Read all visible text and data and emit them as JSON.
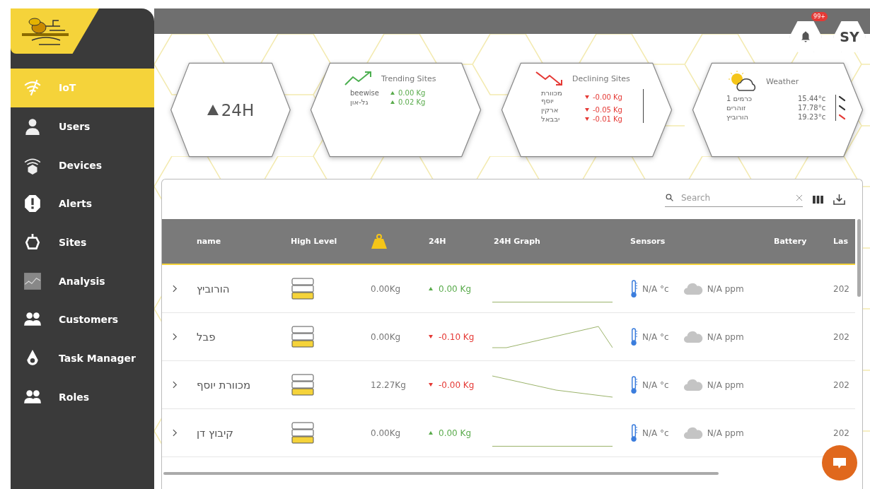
{
  "sidebar": {
    "items": [
      {
        "label": "IoT",
        "selected": true
      },
      {
        "label": "Users",
        "selected": false
      },
      {
        "label": "Devices",
        "selected": false
      },
      {
        "label": "Alerts",
        "selected": false
      },
      {
        "label": "Sites",
        "selected": false
      },
      {
        "label": "Analysis",
        "selected": false
      },
      {
        "label": "Customers",
        "selected": false
      },
      {
        "label": "Task Manager",
        "selected": false
      },
      {
        "label": "Roles",
        "selected": false
      }
    ]
  },
  "header": {
    "notification_count": "99+",
    "user_initials": "SY"
  },
  "summary": {
    "period": "24H",
    "trending": {
      "title": "Trending Sites",
      "rows": [
        {
          "name": "beewise",
          "value": "0.00 Kg"
        },
        {
          "name": "גל-און",
          "value": "0.02 Kg"
        }
      ]
    },
    "declining": {
      "title": "Declining Sites",
      "rows": [
        {
          "name": "מכוורת יוסף",
          "value": "-0.00 Kg"
        },
        {
          "name": "ארקין",
          "value": "-0.05 Kg"
        },
        {
          "name": "יבבאל",
          "value": "-0.01 Kg"
        }
      ]
    },
    "weather": {
      "title": "Weather",
      "rows": [
        {
          "name": "כרמים 1",
          "temp": "15.44°c",
          "alert": false
        },
        {
          "name": "זוהרים",
          "temp": "17.78°c",
          "alert": false
        },
        {
          "name": "הורוביץ",
          "temp": "19.23°c",
          "alert": true
        }
      ]
    }
  },
  "table": {
    "search": {
      "placeholder": "Search"
    },
    "columns": [
      "name",
      "High Level",
      "24H",
      "24H Graph",
      "Sensors",
      "Battery",
      "Las"
    ],
    "rows": [
      {
        "name": "הורוביץ",
        "weight": "0.00Kg",
        "change": "0.00 Kg",
        "rising": true,
        "kind": "flat",
        "temperature": "N/A °c",
        "co2": "N/A ppm",
        "last": "202"
      },
      {
        "name": "פבל",
        "weight": "0.00Kg",
        "change": "-0.10 Kg",
        "rising": false,
        "kind": "peak",
        "temperature": "N/A °c",
        "co2": "N/A ppm",
        "last": "202"
      },
      {
        "name": "מכוורת יוסף",
        "weight": "12.27Kg",
        "change": "-0.00 Kg",
        "rising": false,
        "kind": "falling",
        "temperature": "N/A °c",
        "co2": "N/A ppm",
        "last": "202"
      },
      {
        "name": "קיבוץ דן",
        "weight": "0.00Kg",
        "change": "0.00 Kg",
        "rising": true,
        "kind": "flat",
        "temperature": "N/A °c",
        "co2": "N/A ppm",
        "last": "202"
      }
    ]
  }
}
